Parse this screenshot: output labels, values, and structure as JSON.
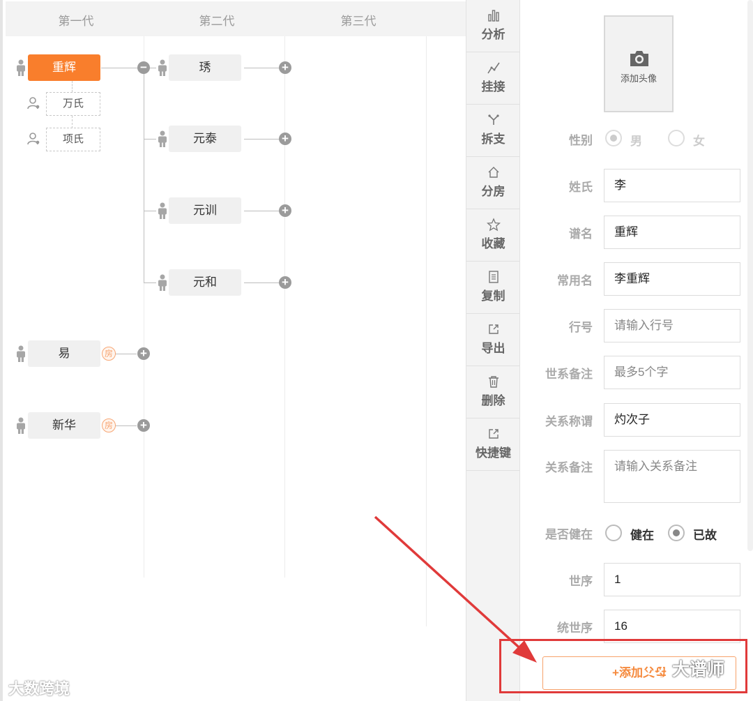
{
  "tree": {
    "generations": [
      "第一代",
      "第二代",
      "第三代"
    ],
    "root": {
      "name": "重辉",
      "spouses": [
        "万氏",
        "项氏"
      ],
      "children": [
        "琇",
        "元泰",
        "元训",
        "元和"
      ]
    },
    "siblings": [
      {
        "name": "易",
        "badge": "房"
      },
      {
        "name": "新华",
        "badge": "房"
      }
    ]
  },
  "toolbar": {
    "items": [
      {
        "label": "分析",
        "icon": "bar-chart-icon"
      },
      {
        "label": "挂接",
        "icon": "link-line-icon"
      },
      {
        "label": "拆支",
        "icon": "branch-split-icon"
      },
      {
        "label": "分房",
        "icon": "house-icon"
      },
      {
        "label": "收藏",
        "icon": "star-icon"
      },
      {
        "label": "复制",
        "icon": "copy-icon"
      },
      {
        "label": "导出",
        "icon": "export-icon"
      },
      {
        "label": "删除",
        "icon": "trash-icon"
      },
      {
        "label": "快捷键",
        "icon": "shortcut-icon"
      }
    ]
  },
  "form": {
    "avatar_label": "添加头像",
    "gender": {
      "label": "性别",
      "options": [
        "男",
        "女"
      ],
      "selected": "男"
    },
    "surname": {
      "label": "姓氏",
      "value": "李"
    },
    "genealogy_name": {
      "label": "谱名",
      "value": "重辉"
    },
    "common_name": {
      "label": "常用名",
      "value": "李重辉"
    },
    "rank": {
      "label": "行号",
      "placeholder": "请输入行号"
    },
    "lineage_note": {
      "label": "世系备注",
      "placeholder": "最多5个字"
    },
    "relation_title": {
      "label": "关系称谓",
      "value": "灼次子"
    },
    "relation_note": {
      "label": "关系备注",
      "placeholder": "请输入关系备注"
    },
    "alive": {
      "label": "是否健在",
      "options": [
        "健在",
        "已故"
      ],
      "selected": "已故"
    },
    "generation_order": {
      "label": "世序",
      "value": "1"
    },
    "unified_order": {
      "label": "统世序",
      "value": "16"
    },
    "add_button": "+添加父母"
  },
  "watermarks": {
    "chat": "大谱师",
    "bottom": "大数跨境"
  },
  "colors": {
    "accent": "#f97e2c",
    "annotation_red": "#e03a3a"
  }
}
